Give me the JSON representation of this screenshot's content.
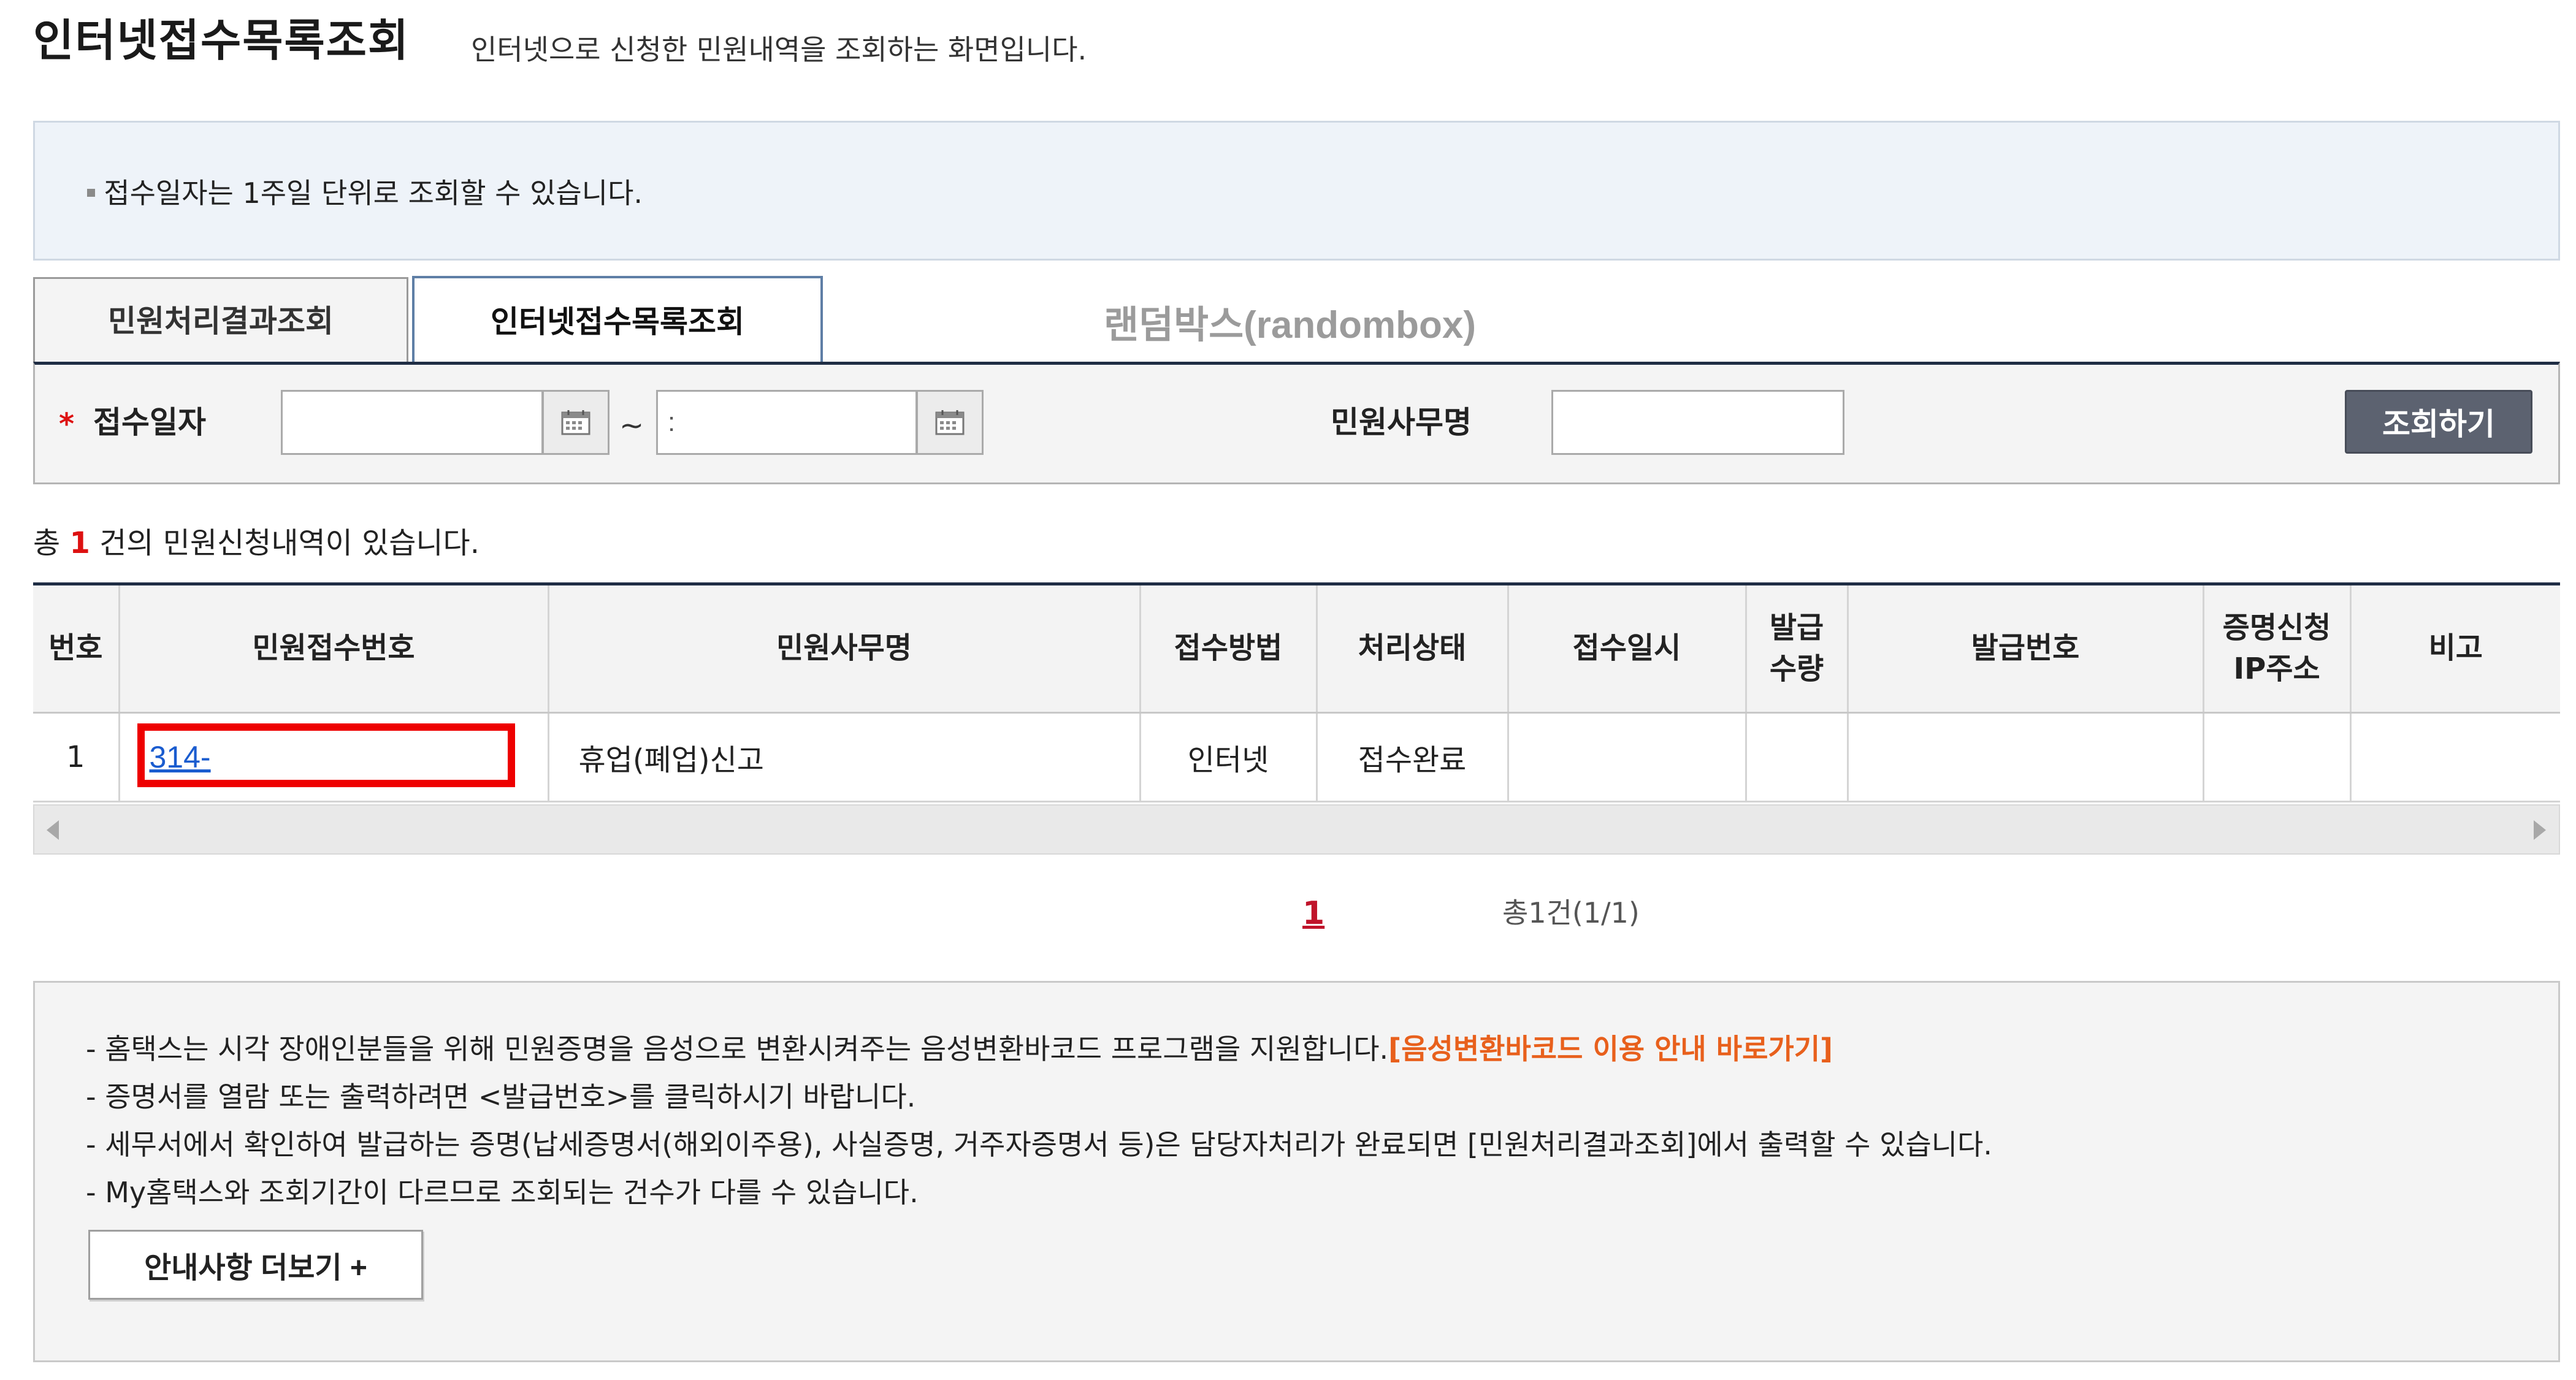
{
  "header": {
    "title": "인터넷접수목록조회",
    "subtitle": "인터넷으로 신청한 민원내역을 조회하는 화면입니다."
  },
  "notice": {
    "text": "접수일자는 1주일 단위로 조회할 수 있습니다."
  },
  "tabs": [
    {
      "label": "민원처리결과조회",
      "active": false
    },
    {
      "label": "인터넷접수목록조회",
      "active": true
    }
  ],
  "watermark": "랜덤박스(randombox)",
  "search": {
    "required_mark": "*",
    "date_label": "접수일자",
    "date_from_value": "",
    "date_to_value": ":",
    "separator": "~",
    "office_label": "민원사무명",
    "office_value": "",
    "button_label": "조회하기"
  },
  "count": {
    "prefix": "총",
    "value": "1",
    "suffix": "건의 민원신청내역이 있습니다."
  },
  "table": {
    "headers": [
      "번호",
      "민원접수번호",
      "민원사무명",
      "접수방법",
      "처리상태",
      "접수일시",
      "발급\n수량",
      "발급번호",
      "증명신청\nIP주소",
      "비고"
    ],
    "rows": [
      {
        "no": "1",
        "receipt_no": "314-",
        "office_name": "휴업(폐업)신고",
        "method": "인터넷",
        "status": "접수완료",
        "received_at": "",
        "issue_qty": "",
        "issue_no": "",
        "ip": "",
        "note": ""
      }
    ]
  },
  "pagination": {
    "current_page": "1",
    "total_text": "총1건(1/1)"
  },
  "info": {
    "line1_text": "- 홈택스는 시각 장애인분들을 위해 민원증명을 음성으로 변환시켜주는 음성변환바코드 프로그램을 지원합니다.",
    "line1_link": "[음성변환바코드 이용 안내 바로가기]",
    "line2": "- 증명서를 열람 또는 출력하려면 <발급번호>를 클릭하시기 바랍니다.",
    "line3": "- 세무서에서 확인하여 발급하는 증명(납세증명서(해외이주용), 사실증명, 거주자증명서 등)은 담당자처리가 완료되면 [민원처리결과조회]에서 출력할 수 있습니다.",
    "line4": "- My홈택스와 조회기간이 다르므로 조회되는 건수가 다를 수 있습니다.",
    "more_button": "안내사항 더보기 +"
  },
  "colors": {
    "accent_dark": "#1f2d44",
    "highlight": "#ee0000",
    "link": "#1a5ccf",
    "info_link": "#e8601c",
    "required": "#dd1111",
    "button_bg": "#5c6270"
  }
}
